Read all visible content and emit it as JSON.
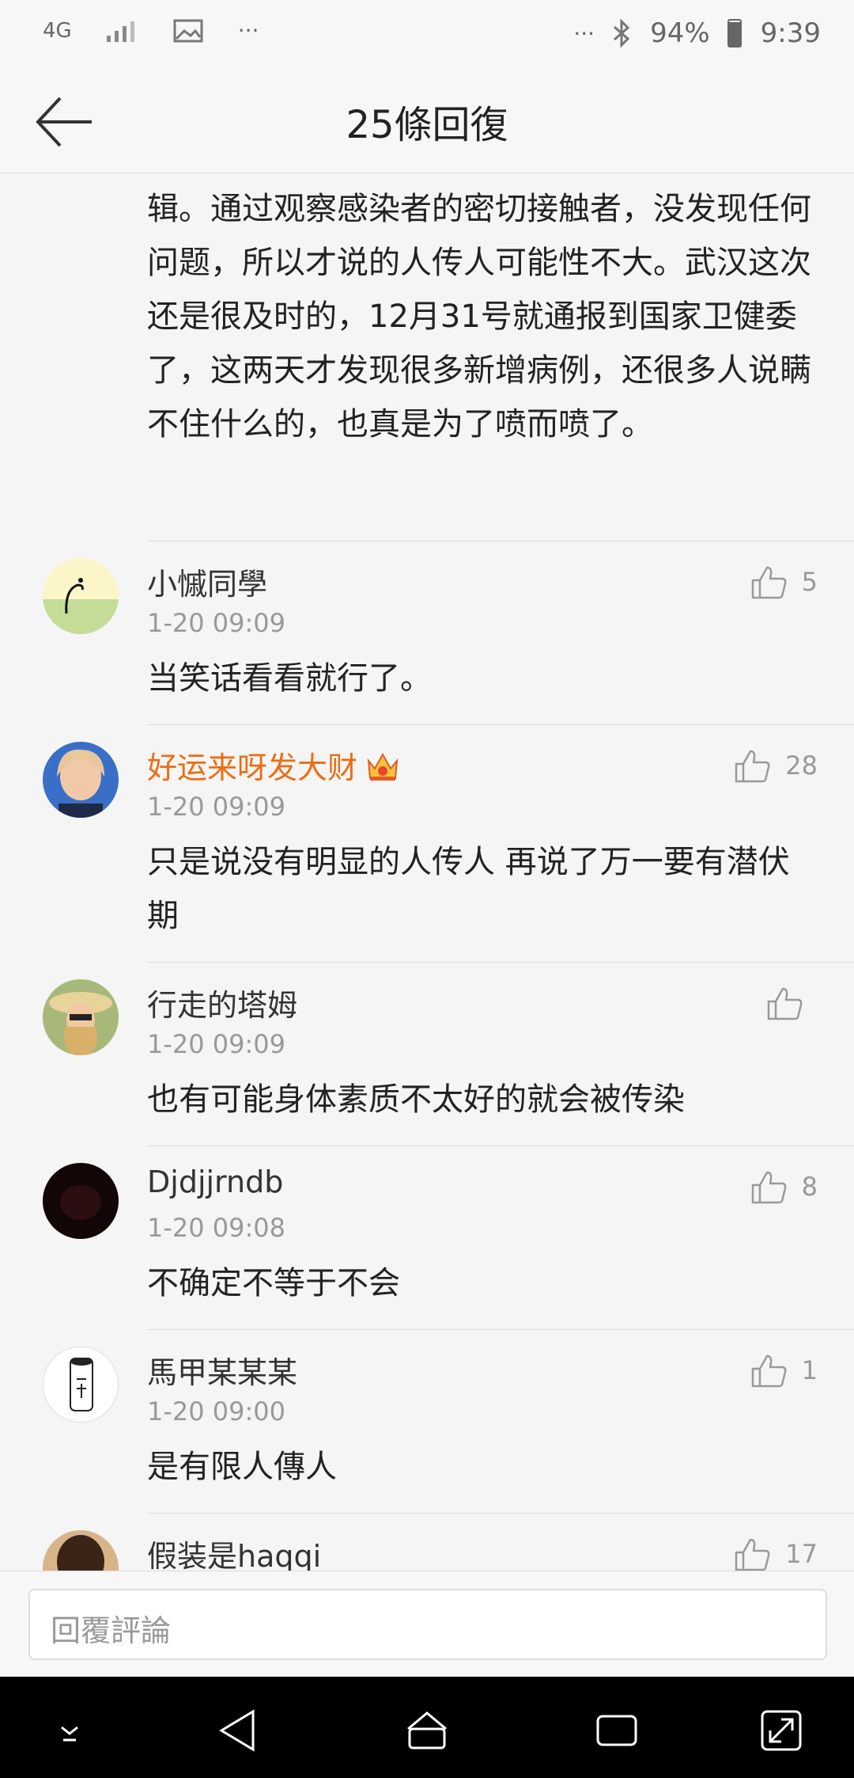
{
  "status": {
    "network": "4G",
    "battery": "94%",
    "time": "9:39",
    "more_left": "···",
    "more_right": "···"
  },
  "header": {
    "title": "25條回復"
  },
  "first_comment": {
    "text": "很多人都只会喷官方，但是没思考一下里面的逻辑。通过观察感染者的密切接触者，没发现任何问题，所以才说的人传人可能性不大。武汉这次还是很及时的，12月31号就通报到国家卫健委了，这两天才发现很多新增病例，还很多人说瞒不住什么的，也真是为了喷而喷了。"
  },
  "comments": [
    {
      "name": "小慽同學",
      "time": "1-20 09:09",
      "text": "当笑话看看就行了。",
      "likes": "5",
      "vip": false,
      "avatar": "cat-avatar"
    },
    {
      "name": "好运来呀发大财",
      "time": "1-20 09:09",
      "text": "只是说没有明显的人传人 再说了万一要有潜伏期",
      "likes": "28",
      "vip": true,
      "avatar": "girl-avatar"
    },
    {
      "name": "行走的塔姆",
      "time": "1-20 09:09",
      "text": "也有可能身体素质不太好的就会被传染",
      "likes": "",
      "vip": false,
      "avatar": "sunhat-avatar"
    },
    {
      "name": "Djdjjrndb",
      "time": "1-20 09:08",
      "text": "不确定不等于不会",
      "likes": "8",
      "vip": false,
      "avatar": "dark-avatar"
    },
    {
      "name": "馬甲某某某",
      "time": "1-20 09:00",
      "text": "是有限人傳人",
      "likes": "1",
      "vip": false,
      "avatar": "can-avatar"
    },
    {
      "name": "假装是haqqi",
      "time": "",
      "text": "",
      "likes": "17",
      "vip": false,
      "avatar": "partial-avatar"
    }
  ],
  "reply_input": {
    "placeholder": "回覆評論"
  }
}
